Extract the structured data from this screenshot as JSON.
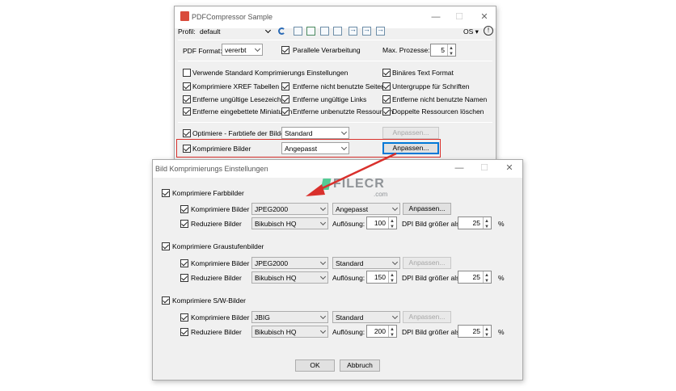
{
  "main_window": {
    "title": "PDFCompressor Sample",
    "profile_label": "Profil:",
    "profile_value": "default",
    "os_label": "OS",
    "pdf_format_label": "PDF Format:",
    "pdf_format_value": "vererbt",
    "parallel_label": "Parallele Verarbeitung",
    "max_processes_label": "Max. Prozesse:",
    "max_processes_value": "5",
    "options": [
      {
        "label": "Verwende Standard Komprimierungs Einstellungen",
        "checked": false
      },
      {
        "label": "Binäres Text Format",
        "checked": true
      },
      {
        "label": "Komprimiere XREF Tabellen",
        "checked": true
      },
      {
        "label": "Entferne nicht benutzte Seiten",
        "checked": true
      },
      {
        "label": "Untergruppe für Schriften",
        "checked": true
      },
      {
        "label": "Entferne ungültige Lesezeichen",
        "checked": true
      },
      {
        "label": "Entferne ungültige Links",
        "checked": true
      },
      {
        "label": "Entferne nicht benutzte Namen",
        "checked": true
      },
      {
        "label": "Entferne eingebettete Miniaturen",
        "checked": true
      },
      {
        "label": "Entferne unbenutzte Ressourcen",
        "checked": true
      },
      {
        "label": "Doppelte Ressourcen löschen",
        "checked": true
      }
    ],
    "optimize_colors_label": "Optimiere - Farbtiefe der Bilder",
    "optimize_colors_value": "Standard",
    "optimize_colors_button": "Anpassen...",
    "compress_images_label": "Komprimiere Bilder",
    "compress_images_value": "Angepasst",
    "compress_images_button": "Anpassen..."
  },
  "dialog": {
    "title": "Bild Komprimierungs Einstellungen",
    "groups": [
      {
        "label": "Komprimiere Farbbilder",
        "compress_label": "Komprimiere Bilder",
        "codec": "JPEG2000",
        "quality": "Angepasst",
        "customize_button": "Anpassen...",
        "customize_enabled": true,
        "reduce_label": "Reduziere Bilder",
        "method": "Bikubisch HQ",
        "resolution_label": "Auflösung:",
        "resolution": "100",
        "dpi_label": "DPI Bild größer als:",
        "dpi": "25",
        "percent": "%"
      },
      {
        "label": "Komprimiere Graustufenbilder",
        "compress_label": "Komprimiere Bilder",
        "codec": "JPEG2000",
        "quality": "Standard",
        "customize_button": "Anpassen...",
        "customize_enabled": false,
        "reduce_label": "Reduziere Bilder",
        "method": "Bikubisch HQ",
        "resolution_label": "Auflösung:",
        "resolution": "150",
        "dpi_label": "DPI Bild größer als:",
        "dpi": "25",
        "percent": "%"
      },
      {
        "label": "Komprimiere S/W-Bilder",
        "compress_label": "Komprimiere Bilder",
        "codec": "JBIG",
        "quality": "Standard",
        "customize_button": "Anpassen...",
        "customize_enabled": false,
        "reduce_label": "Reduziere Bilder",
        "method": "Bikubisch HQ",
        "resolution_label": "Auflösung:",
        "resolution": "200",
        "dpi_label": "DPI Bild größer als:",
        "dpi": "25",
        "percent": "%"
      }
    ],
    "ok_button": "OK",
    "cancel_button": "Abbruch"
  },
  "watermark": {
    "text": "FILECR",
    "sub": ".com"
  },
  "colors": {
    "highlight": "#d9302c",
    "arrow": "#d9302c",
    "focus": "#0078d7"
  }
}
